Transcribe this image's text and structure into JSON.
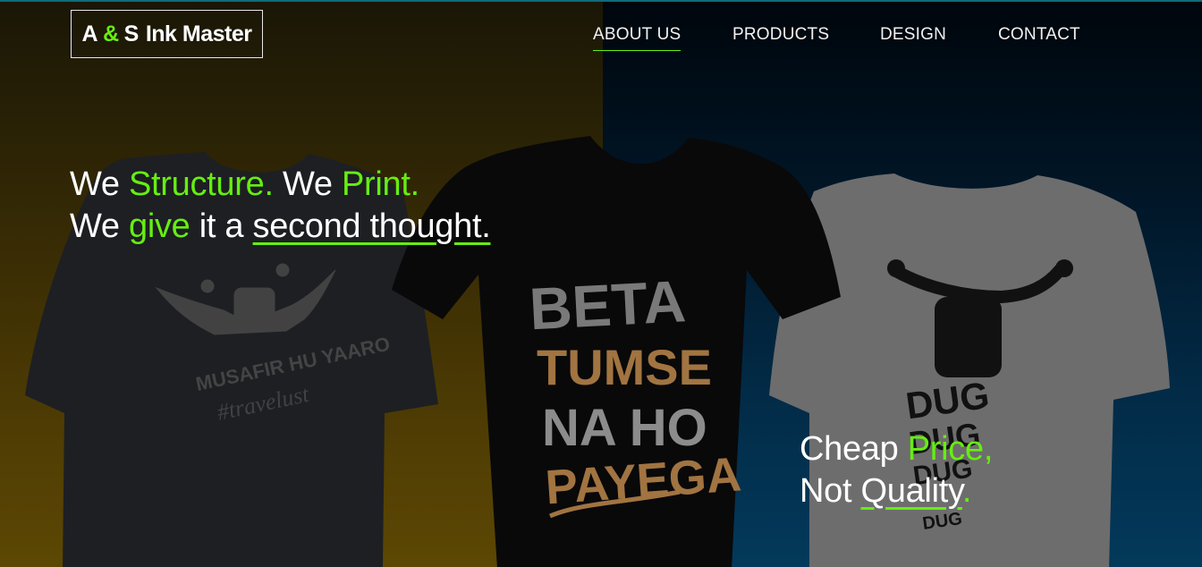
{
  "logo": {
    "a": "A",
    "amp": "&",
    "s": "S",
    "name": "Ink Master"
  },
  "nav": {
    "items": [
      {
        "label": "ABOUT US",
        "active": true
      },
      {
        "label": "PRODUCTS",
        "active": false
      },
      {
        "label": "DESIGN",
        "active": false
      },
      {
        "label": "CONTACT",
        "active": false
      }
    ]
  },
  "hero": {
    "line1": {
      "w1": "We",
      "g1": "Structure.",
      "w2": "We",
      "g2": "Print."
    },
    "line2": {
      "w1": "We",
      "g1": "give",
      "w2": "it a",
      "u1": "second thought."
    },
    "tag2": {
      "w1": "Cheap",
      "g1": "Price,",
      "w2": "Not",
      "u1": "Quality",
      "g2": "."
    }
  },
  "shirts": {
    "left": {
      "text1": "MUSAFIR HU YAARO",
      "text2": "#travelust"
    },
    "center": {
      "line1": "BETA",
      "line2": "TUMSE",
      "line3": "NA HO",
      "line4": "PAYEGA"
    },
    "right": {
      "line1": "DUG",
      "line2": "DUG",
      "line3": "DUG",
      "line4": "DUG"
    }
  },
  "colors": {
    "accent": "#66ee11",
    "text": "#ffffff",
    "shirt_text": "#b8844a"
  }
}
